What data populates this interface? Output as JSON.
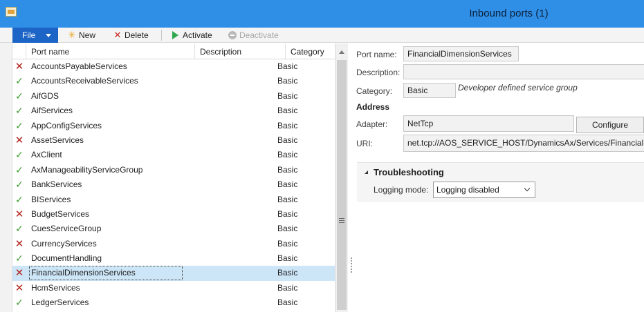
{
  "window": {
    "title": "Inbound ports (1)"
  },
  "ribbon": {
    "file_label": "File",
    "new_label": "New",
    "delete_label": "Delete",
    "activate_label": "Activate",
    "deactivate_label": "Deactivate"
  },
  "grid": {
    "columns": {
      "name": "Port name",
      "description": "Description",
      "category": "Category"
    },
    "rows": [
      {
        "status": "inactive",
        "name": "AccountsPayableServices",
        "category": "Basic"
      },
      {
        "status": "active",
        "name": "AccountsReceivableServices",
        "category": "Basic"
      },
      {
        "status": "active",
        "name": "AifGDS",
        "category": "Basic"
      },
      {
        "status": "active",
        "name": "AifServices",
        "category": "Basic"
      },
      {
        "status": "active",
        "name": "AppConfigServices",
        "category": "Basic"
      },
      {
        "status": "inactive",
        "name": "AssetServices",
        "category": "Basic"
      },
      {
        "status": "active",
        "name": "AxClient",
        "category": "Basic"
      },
      {
        "status": "active",
        "name": "AxManageabilityServiceGroup",
        "category": "Basic"
      },
      {
        "status": "active",
        "name": "BankServices",
        "category": "Basic"
      },
      {
        "status": "active",
        "name": "BIServices",
        "category": "Basic"
      },
      {
        "status": "inactive",
        "name": "BudgetServices",
        "category": "Basic"
      },
      {
        "status": "active",
        "name": "CuesServiceGroup",
        "category": "Basic"
      },
      {
        "status": "inactive",
        "name": "CurrencyServices",
        "category": "Basic"
      },
      {
        "status": "active",
        "name": "DocumentHandling",
        "category": "Basic"
      },
      {
        "status": "inactive",
        "name": "FinancialDimensionServices",
        "category": "Basic",
        "selected": true
      },
      {
        "status": "inactive",
        "name": "HcmServices",
        "category": "Basic"
      },
      {
        "status": "active",
        "name": "LedgerServices",
        "category": "Basic"
      }
    ]
  },
  "details": {
    "port_name_label": "Port name:",
    "port_name_value": "FinancialDimensionServices",
    "description_label": "Description:",
    "description_value": "",
    "category_label": "Category:",
    "category_value": "Basic",
    "category_note": "Developer defined service group",
    "address_heading": "Address",
    "adapter_label": "Adapter:",
    "adapter_value": "NetTcp",
    "configure_label": "Configure",
    "uri_label": "URI:",
    "uri_value": "net.tcp://AOS_SERVICE_HOST/DynamicsAx/Services/FinancialDi"
  },
  "troubleshooting": {
    "heading": "Troubleshooting",
    "logging_mode_label": "Logging mode:",
    "logging_mode_value": "Logging disabled"
  },
  "colors": {
    "titlebar": "#2f8fe6",
    "file_button": "#1c64c6",
    "selected_row": "#cde6f7",
    "active_check": "#3c9a2e",
    "inactive_x": "#b3261e"
  }
}
